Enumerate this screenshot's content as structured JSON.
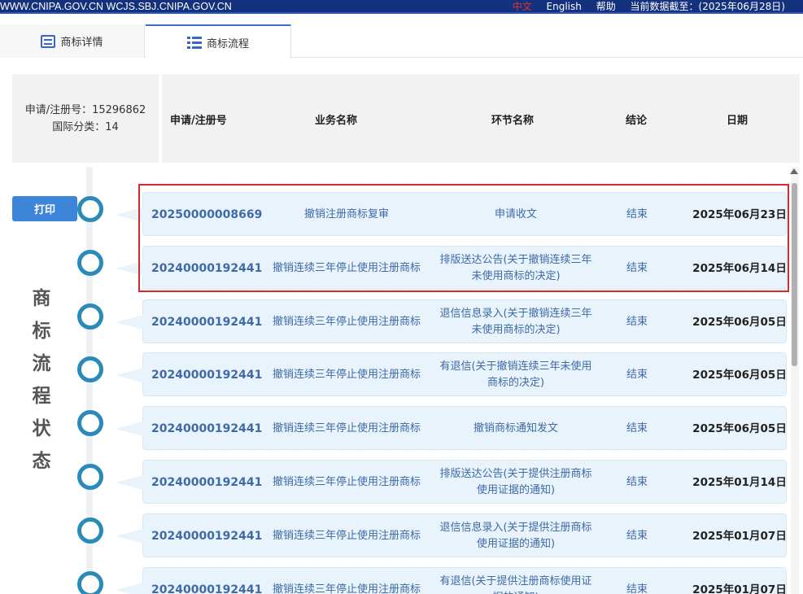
{
  "topbar": {
    "domains": "WWW.CNIPA.GOV.CN WCJS.SBJ.CNIPA.GOV.CN",
    "lang_zh": "中文",
    "lang_en": "English",
    "help": "帮助",
    "data_cutoff": "当前数据截至：(2025年06月28日)"
  },
  "tabs": [
    {
      "label": "商标详情",
      "icon": "doc-icon"
    },
    {
      "label": "商标流程",
      "icon": "list-icon",
      "active": true
    }
  ],
  "info": {
    "reg_no": "申请/注册号：15296862",
    "intl_class": "国际分类：14"
  },
  "table": {
    "headers": {
      "no": "申请/注册号",
      "biz": "业务名称",
      "step": "环节名称",
      "result": "结论",
      "date": "日期"
    },
    "rows": [
      {
        "no": "20250000008669",
        "biz": "撤销注册商标复审",
        "step": "申请收文",
        "result": "结束",
        "date": "2025年06月23日"
      },
      {
        "no": "20240000192441",
        "biz": "撤销连续三年停止使用注册商标",
        "step": "排版送达公告(关于撤销连续三年未使用商标的决定)",
        "result": "结束",
        "date": "2025年06月14日"
      },
      {
        "no": "20240000192441",
        "biz": "撤销连续三年停止使用注册商标",
        "step": "退信信息录入(关于撤销连续三年未使用商标的决定)",
        "result": "结束",
        "date": "2025年06月05日"
      },
      {
        "no": "20240000192441",
        "biz": "撤销连续三年停止使用注册商标",
        "step": "有退信(关于撤销连续三年未使用商标的决定)",
        "result": "结束",
        "date": "2025年06月05日"
      },
      {
        "no": "20240000192441",
        "biz": "撤销连续三年停止使用注册商标",
        "step": "撤销商标通知发文",
        "result": "结束",
        "date": "2025年06月05日"
      },
      {
        "no": "20240000192441",
        "biz": "撤销连续三年停止使用注册商标",
        "step": "排版送达公告(关于提供注册商标使用证据的通知)",
        "result": "结束",
        "date": "2025年01月14日"
      },
      {
        "no": "20240000192441",
        "biz": "撤销连续三年停止使用注册商标",
        "step": "退信信息录入(关于提供注册商标使用证据的通知)",
        "result": "结束",
        "date": "2025年01月07日"
      },
      {
        "no": "20240000192441",
        "biz": "撤销连续三年停止使用注册商标",
        "step": "有退信(关于提供注册商标使用证据的通知)",
        "result": "结束",
        "date": "2025年01月07日"
      }
    ]
  },
  "print_label": "打印",
  "side_title": [
    "商",
    "标",
    "流",
    "程",
    "状",
    "态"
  ],
  "colors": {
    "topbar": "#14317d",
    "accent": "#3d85d8",
    "row_bg": "#e8f3fb",
    "highlight": "#d9282b",
    "timeline_circle": "#2a8ab8"
  }
}
